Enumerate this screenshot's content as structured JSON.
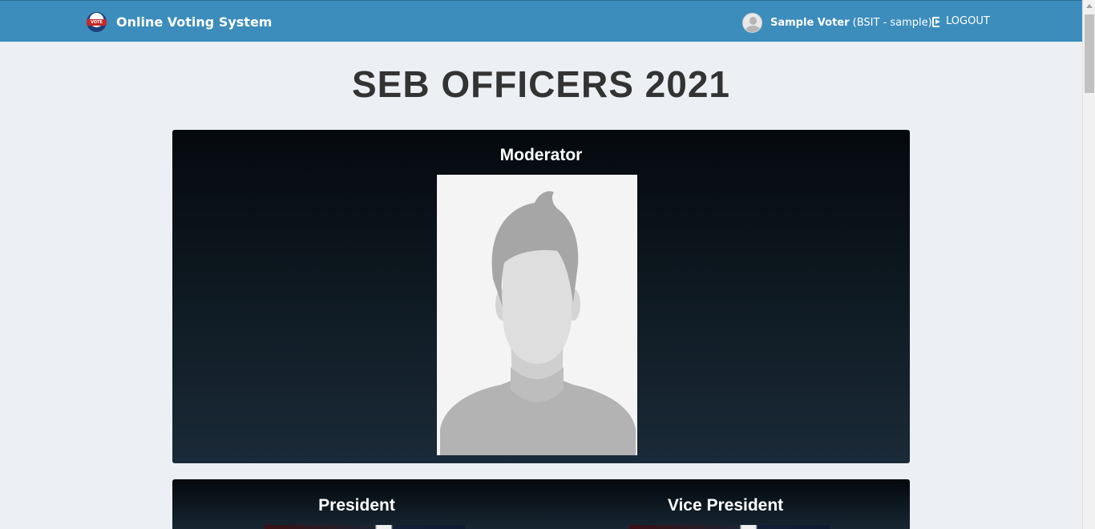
{
  "header": {
    "brand": "Online Voting System",
    "logo_text": "VOTE",
    "user": {
      "name": "Sample Voter",
      "detail": "(BSIT - sample)"
    },
    "logout_label": "LOGOUT"
  },
  "main": {
    "title": "SEB OFFICERS 2021",
    "positions": [
      {
        "label": "Moderator"
      },
      {
        "label": "President"
      },
      {
        "label": "Vice President"
      }
    ]
  },
  "colors": {
    "navbar": "#3c8dbc",
    "background": "#ecf0f5",
    "box_dark": "#05090d"
  },
  "icons": {
    "logout": "sign-out-icon",
    "avatar": "user-avatar",
    "logo": "vote-badge-icon"
  }
}
